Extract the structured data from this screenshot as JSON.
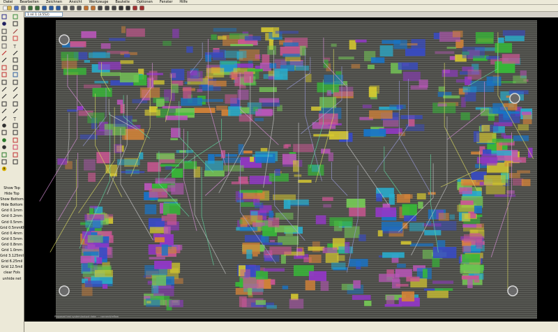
{
  "menu": [
    "Datei",
    "Bearbeiten",
    "Zeichnen",
    "Ansicht",
    "Werkzeuge",
    "Bauteile",
    "Optionen",
    "Fenster",
    "Hilfe"
  ],
  "tab_label": "1 nil 1 (3.552)",
  "right_list": [
    "Show Top",
    "Hide Top",
    "Show Bottom",
    "Hide Bottom",
    "Grid 0.1mm",
    "Grid 0.2mm",
    "Grid 0.5mm",
    "Grid 0.5mmKP",
    "Grid 0.4mm",
    "Grid 0.5mm",
    "Grid 0.8mm",
    "Grid 1.0mm",
    "Grid 3.125mil",
    "Grid 6.25mil",
    "Grid 12.5mil",
    "clear Fols",
    "unhide net"
  ],
  "canvas_caption": "Proposed test system/output data: ... connect/reflow",
  "status_text": "",
  "colors": {
    "board": "#4d4e4a",
    "panel": "#ece9d8",
    "canvas_bg": "#000000"
  },
  "icons": [
    "new-file-icon",
    "open-folder-icon",
    "save-icon",
    "print-icon",
    "undo-icon",
    "redo-icon",
    "zoom-in-icon",
    "zoom-out-icon",
    "zoom-fit-icon",
    "pointer-icon",
    "eye-icon",
    "move-icon",
    "rotate-icon",
    "line-icon",
    "circle-icon",
    "rectangle-icon",
    "via-icon",
    "pad-icon",
    "text-icon",
    "measure-icon",
    "delete-icon",
    "warning-icon"
  ]
}
